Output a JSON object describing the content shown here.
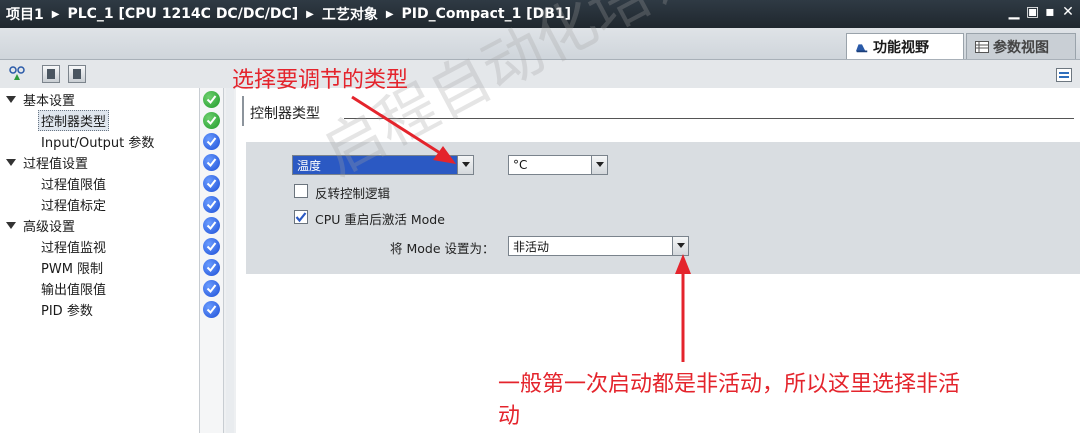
{
  "title_bar": {
    "crumbs": [
      "项目1",
      "PLC_1 [CPU 1214C DC/DC/DC]",
      "工艺对象",
      "PID_Compact_1 [DB1]"
    ],
    "separator": "▶"
  },
  "view_tabs": [
    {
      "label": "功能视野",
      "active": true,
      "icon": "function-view-icon"
    },
    {
      "label": "参数视图",
      "active": false,
      "icon": "parameter-view-icon"
    }
  ],
  "nav_tree": [
    {
      "label": "基本设置",
      "level": 0,
      "expanded": true,
      "status": "ok"
    },
    {
      "label": "控制器类型",
      "level": 1,
      "selected": true,
      "status": "ok"
    },
    {
      "label": "Input/Output 参数",
      "level": 1,
      "status": "info"
    },
    {
      "label": "过程值设置",
      "level": 0,
      "expanded": true,
      "status": "info"
    },
    {
      "label": "过程值限值",
      "level": 1,
      "status": "info"
    },
    {
      "label": "过程值标定",
      "level": 1,
      "status": "info"
    },
    {
      "label": "高级设置",
      "level": 0,
      "expanded": true,
      "status": "info"
    },
    {
      "label": "过程值监视",
      "level": 1,
      "status": "info"
    },
    {
      "label": "PWM 限制",
      "level": 1,
      "status": "info"
    },
    {
      "label": "输出值限值",
      "level": 1,
      "status": "info"
    },
    {
      "label": "PID 参数",
      "level": 1,
      "status": "info"
    }
  ],
  "main": {
    "section_title": "控制器类型",
    "controller_type": {
      "value": "温度"
    },
    "unit": {
      "value": "°C"
    },
    "invert_control": {
      "label": "反转控制逻辑",
      "checked": false
    },
    "activate_mode": {
      "label": "CPU 重启后激活 Mode",
      "checked": true
    },
    "set_mode": {
      "label": "将 Mode 设置为：",
      "value": "非活动"
    }
  },
  "annotations": {
    "top": "选择要调节的类型",
    "bottom_line1": "一般第一次启动都是非活动，所以这里选择非活",
    "bottom_line2": "动"
  },
  "watermark": "启程自动化培训",
  "colors": {
    "accent_red": "#e4242c",
    "selection_blue": "#2b59c3",
    "status_ok": "#1f9a2a",
    "status_info": "#1d4fd6"
  }
}
